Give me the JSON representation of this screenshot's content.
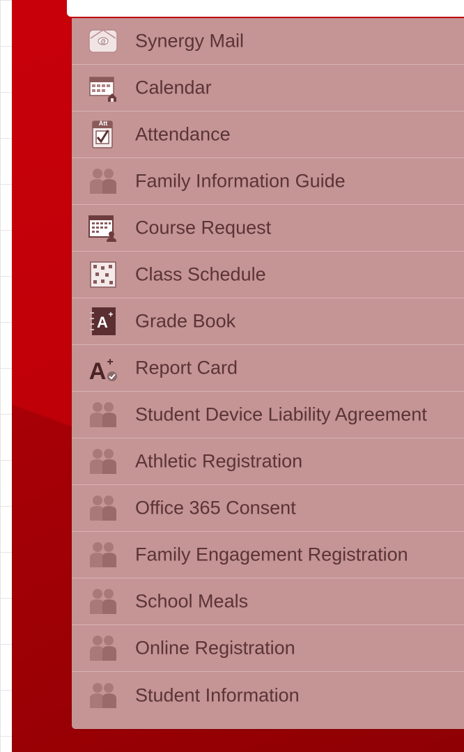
{
  "menu": {
    "items": [
      {
        "label": "Synergy Mail",
        "icon": "mail-icon"
      },
      {
        "label": "Calendar",
        "icon": "calendar-icon"
      },
      {
        "label": "Attendance",
        "icon": "attendance-icon"
      },
      {
        "label": "Family Information Guide",
        "icon": "people-icon"
      },
      {
        "label": "Course Request",
        "icon": "course-request-icon"
      },
      {
        "label": "Class Schedule",
        "icon": "class-schedule-icon"
      },
      {
        "label": "Grade Book",
        "icon": "grade-book-icon"
      },
      {
        "label": "Report Card",
        "icon": "report-card-icon"
      },
      {
        "label": "Student Device Liability Agreement",
        "icon": "people-icon"
      },
      {
        "label": "Athletic Registration",
        "icon": "people-icon"
      },
      {
        "label": "Office 365 Consent",
        "icon": "people-icon"
      },
      {
        "label": "Family Engagement Registration",
        "icon": "people-icon"
      },
      {
        "label": "School Meals",
        "icon": "people-icon"
      },
      {
        "label": "Online Registration",
        "icon": "people-icon"
      },
      {
        "label": "Student Information",
        "icon": "people-icon"
      }
    ],
    "attendance_icon_text": "Att",
    "colors": {
      "panel_red": "#c00008",
      "menu_bg": "#c59495",
      "label_text": "#5a3436",
      "icon_dark": "#7a4446"
    }
  }
}
